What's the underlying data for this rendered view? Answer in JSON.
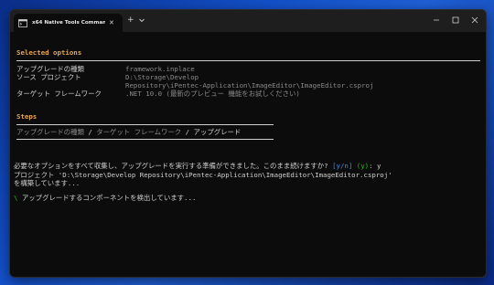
{
  "window": {
    "tab_title": "x64 Native Tools Command Pr",
    "tab_close": "✕",
    "new_tab": "+",
    "icons": [
      "terminal-icon",
      "close-icon",
      "plus-icon",
      "chevron-down-icon",
      "minimize-icon",
      "maximize-icon",
      "close-window-icon"
    ]
  },
  "terminal": {
    "selected_heading": "Selected options",
    "options": [
      {
        "label": "アップグレードの種類",
        "value": "framework.inplace"
      },
      {
        "label": "ソース プロジェクト",
        "value": "D:\\Storage\\Develop"
      },
      {
        "label": "",
        "value": "Repository\\iPentec-Application\\ImageEditor\\ImageEditor.csproj"
      },
      {
        "label": "ターゲット フレームワーク",
        "value": ".NET 10.0 (最新のプレビュー 機能をお試しください)"
      }
    ],
    "steps_heading": "Steps",
    "steps": {
      "step1": "アップグレードの種類 ",
      "sep1": "/ ",
      "step2": "ターゲット フレームワーク ",
      "sep2": "/ ",
      "step3": "アップグレード"
    },
    "prompt": {
      "question": "必要なオプションをすべて収集し、アップグレードを実行する準備ができました。このまま続けますか? ",
      "choices": "[y/n]",
      "default": " (y)",
      "answer": ": y"
    },
    "project_line": "プロジェクト 'D:\\Storage\\Develop Repository\\iPentec-Application\\ImageEditor\\ImageEditor.csproj'",
    "building_line": "を構築しています...",
    "spinner": "\\",
    "detecting_line": " アップグレードするコンポーネントを検出しています..."
  }
}
